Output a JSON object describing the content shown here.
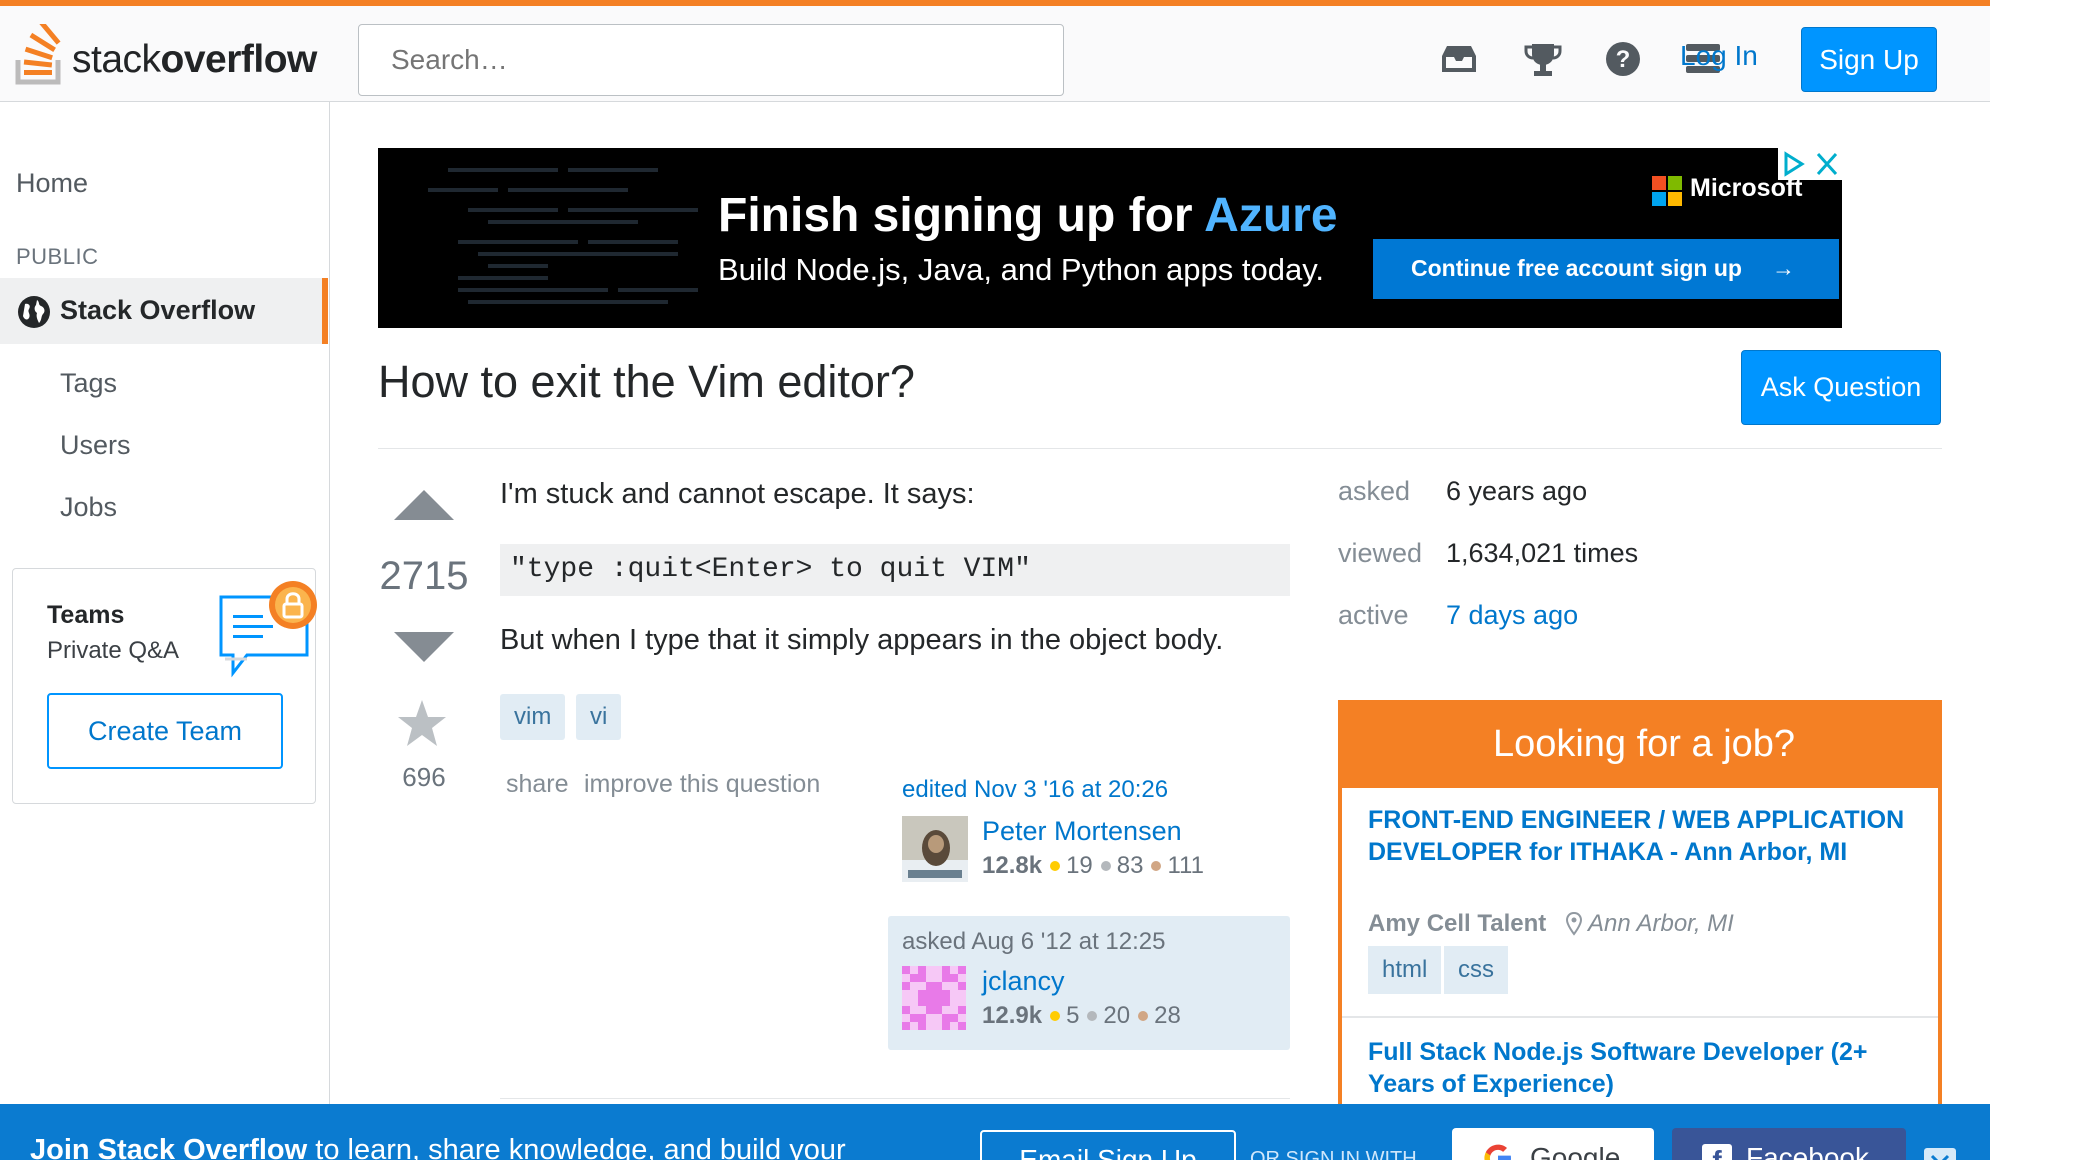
{
  "header": {
    "logo_prefix": "stack",
    "logo_bold": "overflow",
    "search_placeholder": "Search…",
    "login_label": "Log In",
    "signup_label": "Sign Up",
    "icons": [
      "inbox-icon",
      "achievements-trophy-icon",
      "help-icon",
      "site-switcher-icon"
    ]
  },
  "sidebar": {
    "home": "Home",
    "public_label": "PUBLIC",
    "active_item": "Stack Overflow",
    "items": [
      {
        "label": "Tags"
      },
      {
        "label": "Users"
      },
      {
        "label": "Jobs"
      }
    ],
    "teams": {
      "title": "Teams",
      "subtitle": "Private Q&A",
      "button": "Create Team"
    }
  },
  "ad": {
    "headline_prefix": "Finish signing up for ",
    "headline_accent": "Azure",
    "subline": "Build Node.js, Java, and Python apps today.",
    "brand": "Microsoft",
    "cta": "Continue free account sign up",
    "cta_arrow": "→"
  },
  "question": {
    "title": "How to exit the Vim editor?",
    "ask_button": "Ask Question",
    "votes": "2715",
    "favorites": "696",
    "body_intro": "I'm stuck and cannot escape. It says:",
    "code": "\"type :quit<Enter> to quit VIM\"",
    "body_outro": "But when I type that it simply appears in the object body.",
    "tags": [
      "vim",
      "vi"
    ],
    "menu": {
      "share": "share",
      "improve": "improve this question"
    },
    "edited": {
      "time": "edited Nov 3 '16 at 20:26",
      "user": "Peter Mortensen",
      "rep": "12.8k",
      "gold": "19",
      "silver": "83",
      "bronze": "111"
    },
    "asked": {
      "time": "asked Aug 6 '12 at 12:25",
      "user": "jclancy",
      "rep": "12.9k",
      "gold": "5",
      "silver": "20",
      "bronze": "28"
    }
  },
  "stats": [
    {
      "label": "asked",
      "value": "6 years ago"
    },
    {
      "label": "viewed",
      "value": "1,634,021 times"
    },
    {
      "label": "active",
      "value": "7 days ago"
    }
  ],
  "jobs": {
    "heading": "Looking for a job?",
    "listings": [
      {
        "title": "FRONT-END ENGINEER / WEB APPLICATION DEVELOPER for ITHAKA - Ann Arbor, MI",
        "company": "Amy Cell Talent",
        "location": "Ann Arbor, MI",
        "tags": [
          "html",
          "css"
        ]
      },
      {
        "title": "Full Stack Node.js Software Developer (2+ Years of Experience)"
      }
    ]
  },
  "join_banner": {
    "text_bold": "Join Stack Overflow",
    "text_rest": " to learn, share knowledge, and build your",
    "email_button": "Email Sign Up",
    "or_text": "OR SIGN IN WITH",
    "google": "Google",
    "facebook": "Facebook"
  },
  "colors": {
    "brand_orange": "#f48024",
    "link_blue": "#0077cc",
    "button_blue": "#0095ff",
    "tag_bg": "#e1ecf4",
    "tag_text": "#39739d"
  }
}
